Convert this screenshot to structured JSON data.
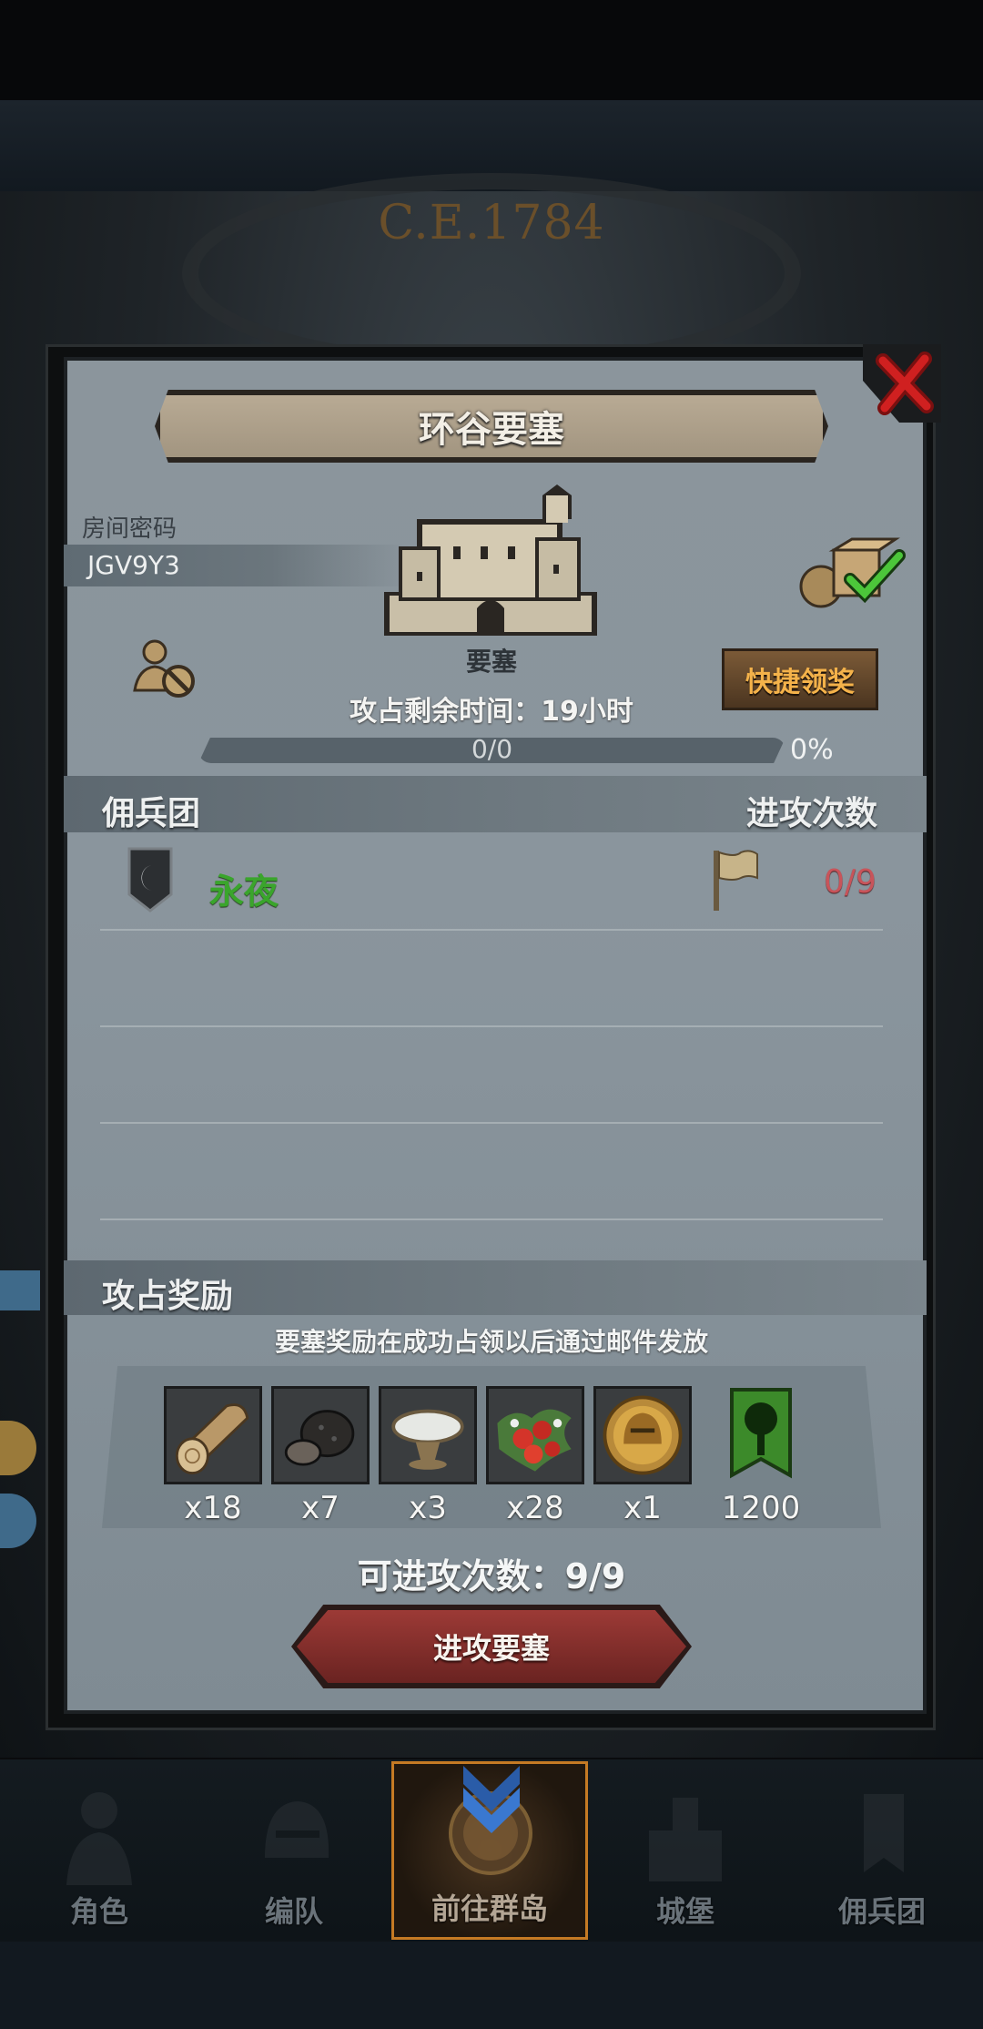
{
  "background": {
    "era_label": "C.E.1784"
  },
  "dialog": {
    "title": "环谷要塞",
    "room": {
      "label": "房间密码",
      "code": "JGV9Y3"
    },
    "fortress": {
      "type_label": "要塞",
      "remaining_time": "攻占剩余时间：19小时"
    },
    "quick_claim_label": "快捷领奖",
    "progress": {
      "text": "0/0",
      "percent_text": "0%",
      "value": 0
    },
    "mercenary_header": "佣兵团",
    "attack_count_header": "进攻次数",
    "guilds": [
      {
        "name": "永夜",
        "attacks": "0/9"
      }
    ],
    "rewards": {
      "header": "攻占奖励",
      "note": "要塞奖励在成功占领以后通过邮件发放",
      "items": [
        {
          "icon": "wood-log-icon",
          "qty": "x18"
        },
        {
          "icon": "truffle-icon",
          "qty": "x7"
        },
        {
          "icon": "silver-dish-icon",
          "qty": "x3"
        },
        {
          "icon": "berries-icon",
          "qty": "x28"
        },
        {
          "icon": "knight-helmet-coin-icon",
          "qty": "x1"
        },
        {
          "icon": "tree-banner-icon",
          "qty": "1200"
        }
      ]
    },
    "attacks_left": "可进攻次数：9/9",
    "attack_button": "进攻要塞"
  },
  "nav": {
    "items": [
      {
        "label": "角色",
        "icon": "knight-icon"
      },
      {
        "label": "编队",
        "icon": "helmet-icon"
      },
      {
        "label": "前往群岛",
        "icon": "compass-icon",
        "active": true
      },
      {
        "label": "城堡",
        "icon": "castle-icon"
      },
      {
        "label": "佣兵团",
        "icon": "mercenary-icon"
      }
    ]
  },
  "colors": {
    "panel": "#8b959c",
    "accent_gold": "#f4b24a",
    "guild_green": "#3aa52c",
    "attack_red": "#c8545a",
    "button_red": "#8a302d"
  }
}
